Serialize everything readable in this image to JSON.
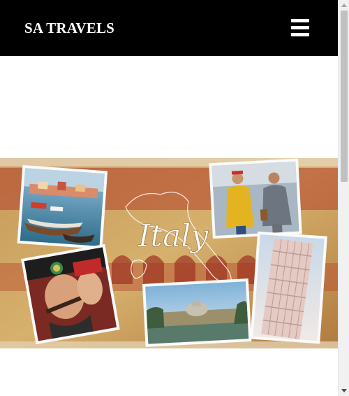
{
  "header": {
    "brand": "SA TRAVELS",
    "menu_icon": "hamburger-menu-icon",
    "background": "#000000"
  },
  "hero": {
    "title_script": "Italy",
    "image_description": "collage-of-italy-travel-photos"
  },
  "scrollbar": {
    "visible": true
  }
}
